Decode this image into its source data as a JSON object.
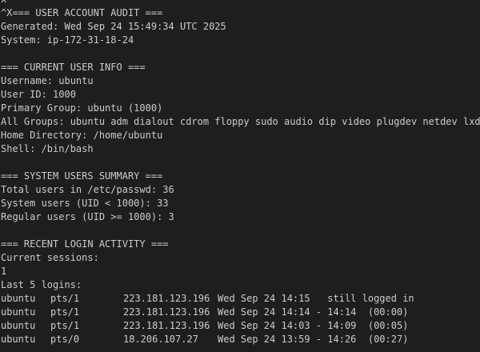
{
  "terminal": {
    "top_line": "x",
    "lines_block1": [
      "^X=== USER ACCOUNT AUDIT ===",
      "Generated: Wed Sep 24 15:49:34 UTC 2025",
      "System: ip-172-31-18-24"
    ],
    "lines_block2": [
      "=== CURRENT USER INFO ===",
      "Username: ubuntu",
      "User ID: 1000",
      "Primary Group: ubuntu (1000)",
      "All Groups: ubuntu adm dialout cdrom floppy sudo audio dip video plugdev netdev lxd",
      "Home Directory: /home/ubuntu",
      "Shell: /bin/bash"
    ],
    "lines_block3": [
      "=== SYSTEM USERS SUMMARY ===",
      "Total users in /etc/passwd: 36",
      "System users (UID < 1000): 33",
      "Regular users (UID >= 1000): 3"
    ],
    "lines_block4": [
      "=== RECENT LOGIN ACTIVITY ===",
      "Current sessions:",
      "1",
      "Last 5 logins:"
    ],
    "logins": [
      {
        "user": "ubuntu",
        "tty": "pts/1",
        "host": "223.181.123.196",
        "time": "Wed Sep 24 14:15   still logged in"
      },
      {
        "user": "ubuntu",
        "tty": "pts/1",
        "host": "223.181.123.196",
        "time": "Wed Sep 24 14:14 - 14:14  (00:00)"
      },
      {
        "user": "ubuntu",
        "tty": "pts/1",
        "host": "223.181.123.196",
        "time": "Wed Sep 24 14:03 - 14:09  (00:05)"
      },
      {
        "user": "ubuntu",
        "tty": "pts/0",
        "host": "18.206.107.27",
        "time": "Wed Sep 24 13:59 - 14:26  (00:27)"
      }
    ]
  }
}
